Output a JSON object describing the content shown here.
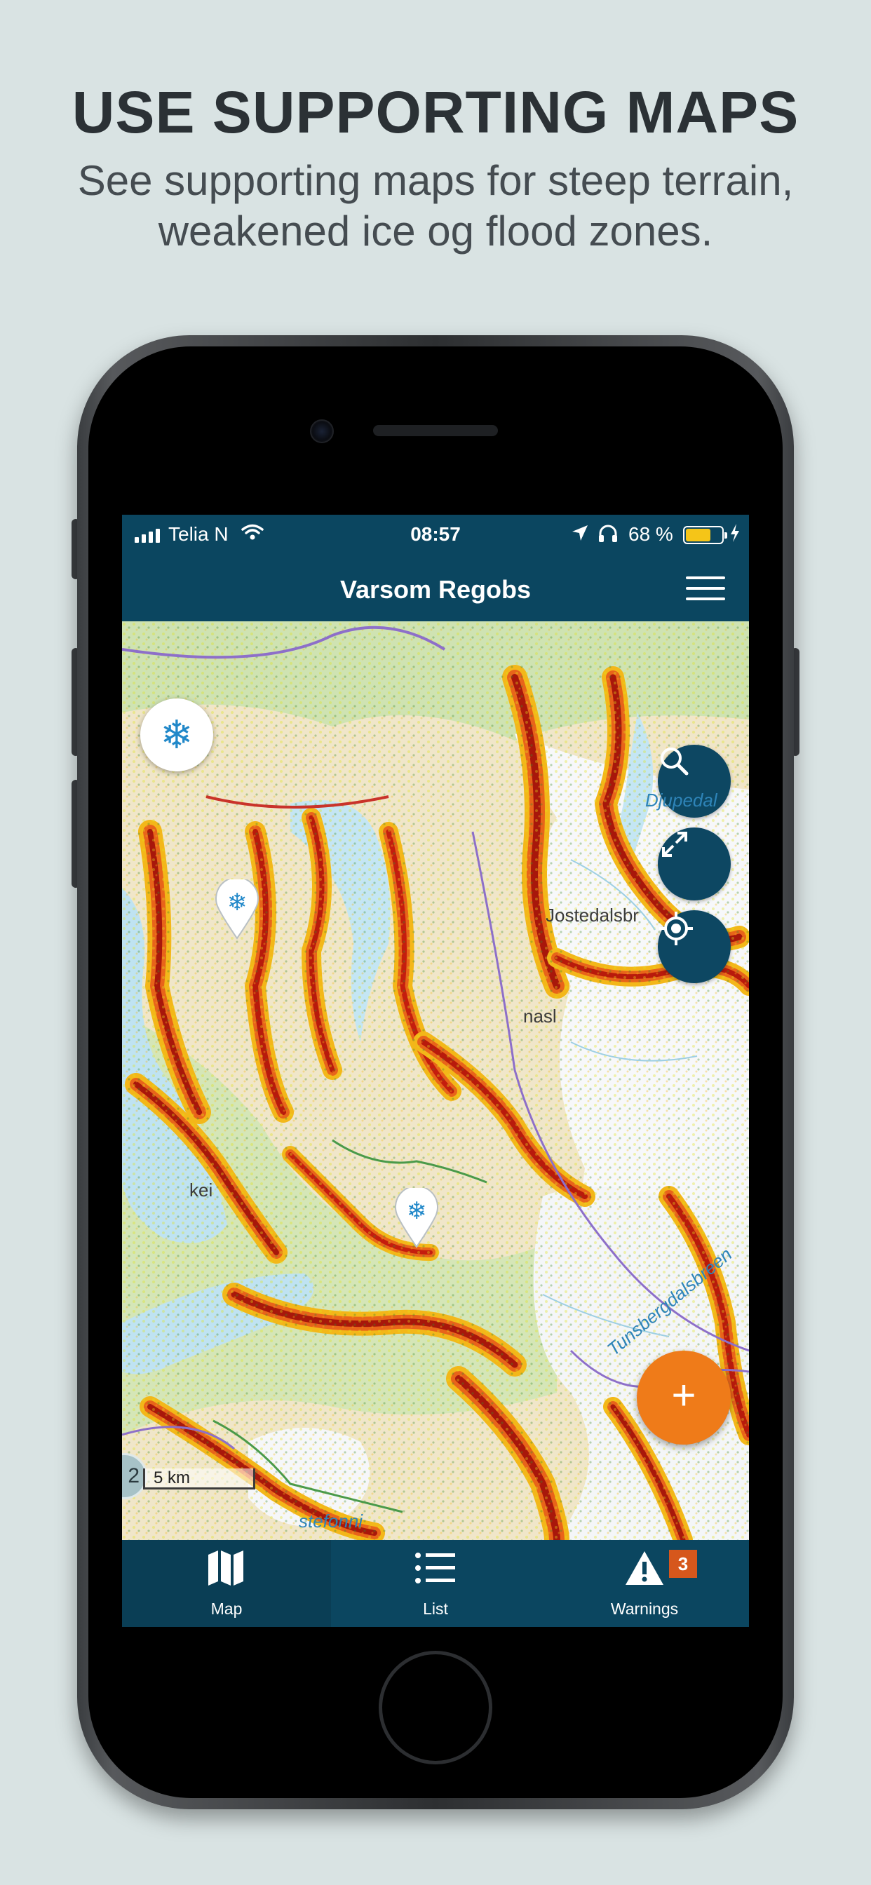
{
  "promo": {
    "title": "USE SUPPORTING MAPS",
    "subtitle_line1": "See supporting maps for steep terrain,",
    "subtitle_line2": "weakened ice og flood zones."
  },
  "status_bar": {
    "carrier": "Telia N",
    "time": "08:57",
    "battery_percent": "68 %",
    "battery_color": "#f5c518"
  },
  "nav": {
    "title": "Varsom Regobs",
    "menu_icon": "hamburger-menu-icon"
  },
  "map": {
    "snowflake_icon": "❄",
    "controls": [
      "search-icon",
      "expand-icon",
      "locate-icon"
    ],
    "markers": [
      "snow-observation",
      "snow-observation"
    ],
    "cluster_count": "2",
    "scale_label": "5 km",
    "place_labels": {
      "northeast": "Djupedal",
      "east_mid": "Jostedalsbr",
      "east_lower": "nasl",
      "west": "kei",
      "glacier": "Tunsbergdalsbreen",
      "south": "stefonni"
    },
    "add_button_label": "+",
    "steepness_colors": [
      "#c41d0e",
      "#e8641a",
      "#f3b719",
      "#dfe21a"
    ]
  },
  "tabs": [
    {
      "label": "Map",
      "icon": "map-icon",
      "active": true
    },
    {
      "label": "List",
      "icon": "list-icon",
      "active": false
    },
    {
      "label": "Warnings",
      "icon": "warning-icon",
      "active": false,
      "badge": "3"
    }
  ],
  "colors": {
    "brand_dark": "#0b4660",
    "accent_orange": "#ef7b19",
    "badge": "#d6571c"
  }
}
